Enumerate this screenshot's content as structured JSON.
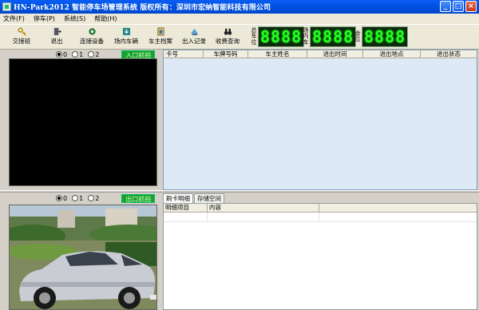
{
  "window": {
    "title": "HN-Park2012 智能停车场管理系统  版权所有：深圳市宏纳智能科技有限公司",
    "minimize": "_",
    "maximize": "□",
    "close": "×"
  },
  "menu": [
    "文件(F)",
    "停车(P)",
    "系统(S)",
    "帮助(H)"
  ],
  "toolbar": {
    "buttons": [
      {
        "label": "交接班",
        "icon": "key-icon"
      },
      {
        "label": "退出",
        "icon": "exit-door-icon"
      },
      {
        "label": "连接设备",
        "icon": "connect-device-icon"
      },
      {
        "label": "场内车辆",
        "icon": "car-list-icon"
      },
      {
        "label": "车主档案",
        "icon": "owner-file-icon"
      },
      {
        "label": "出入记录",
        "icon": "record-icon"
      },
      {
        "label": "收费查询",
        "icon": "binoculars-icon"
      }
    ],
    "counters": [
      {
        "caption": "总车位",
        "value": "8888"
      },
      {
        "caption": "场内车",
        "value": "8888"
      },
      {
        "caption": "余位",
        "value": "8888"
      }
    ]
  },
  "entry_panel": {
    "radios": [
      "0",
      "1",
      "2"
    ],
    "selected": 0,
    "badge": "入口抓拍"
  },
  "exit_panel": {
    "radios": [
      "0",
      "1",
      "2"
    ],
    "selected": 0,
    "badge": "出口抓拍"
  },
  "records_grid": {
    "columns": [
      "卡号",
      "车牌号码",
      "车主姓名",
      "进出时间",
      "进出地点",
      "进出状态"
    ]
  },
  "tabs": [
    "刷卡明细",
    "存储空间"
  ],
  "details_grid": {
    "columns": [
      "明细项目",
      "内容"
    ]
  },
  "colors": {
    "titlebar": "#0052e3",
    "led_digits": "#22ff22",
    "badge": "#19a12a",
    "grid_bg": "#dde9f5"
  }
}
